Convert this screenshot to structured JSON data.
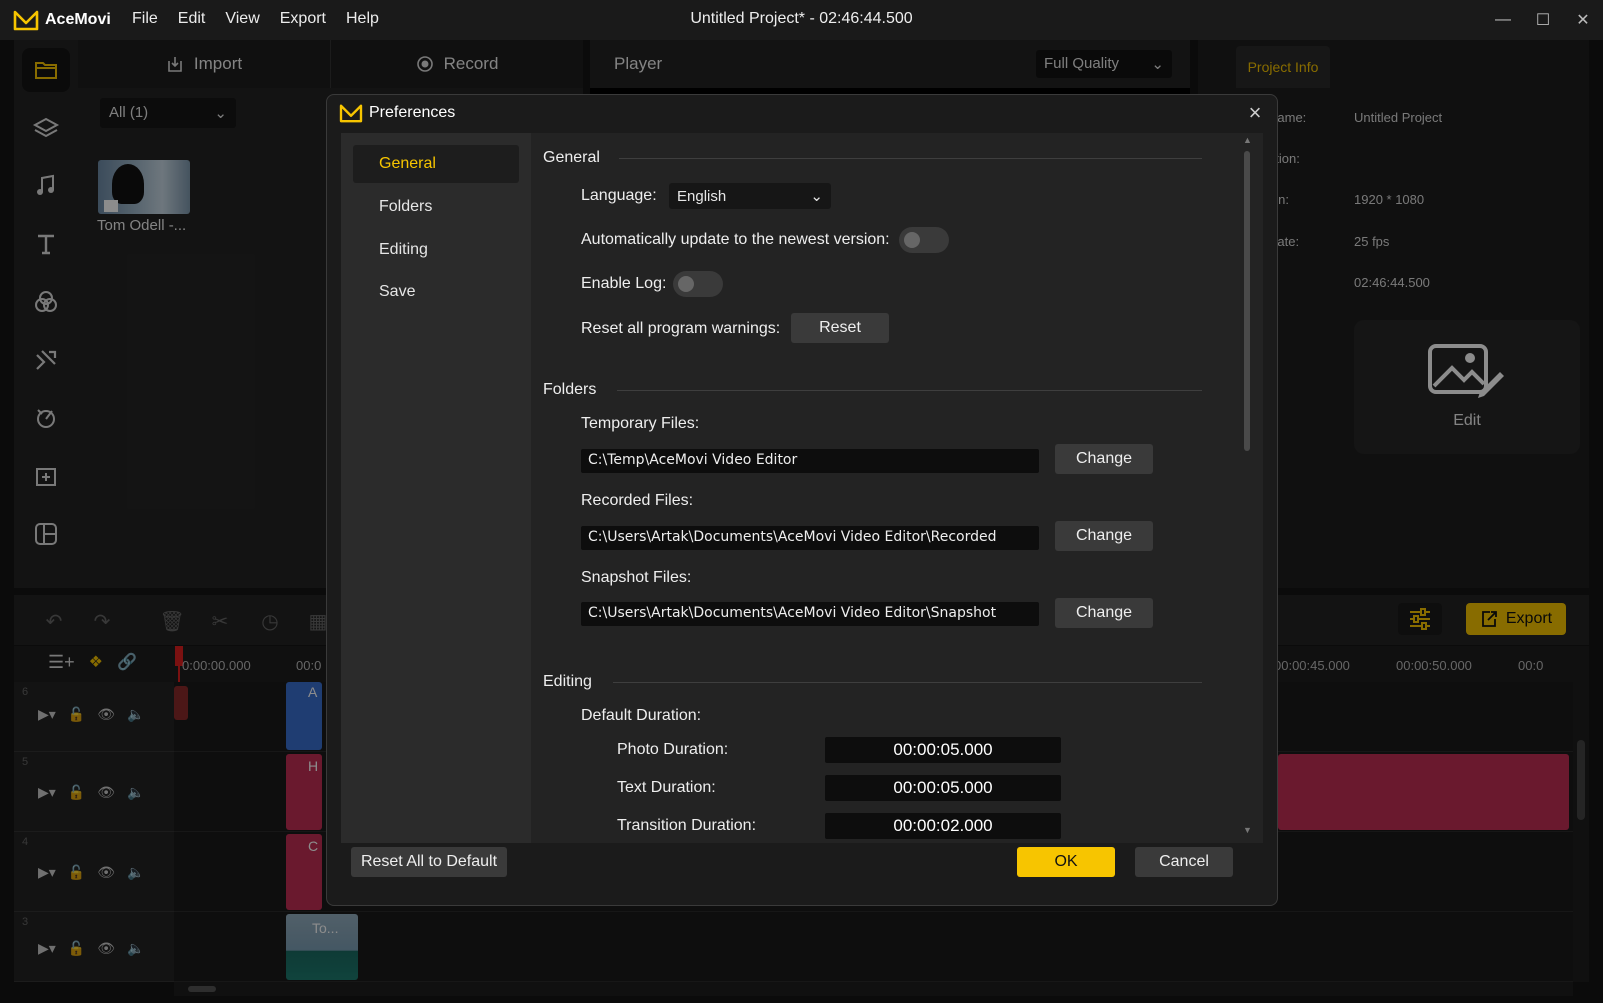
{
  "app": {
    "name": "AceMovi",
    "window_title": "Untitled Project* - 02:46:44.500",
    "menu": [
      "File",
      "Edit",
      "View",
      "Export",
      "Help"
    ]
  },
  "media": {
    "tabs": [
      {
        "label": "Import",
        "icon": "import-icon"
      },
      {
        "label": "Record",
        "icon": "record-icon"
      }
    ],
    "filter": "All (1)",
    "item_label": "Tom Odell -..."
  },
  "player": {
    "title": "Player",
    "quality": "Full Quality"
  },
  "project_info": {
    "tab": "Project Info",
    "rows": [
      {
        "label": "Name:",
        "value": "Untitled Project"
      },
      {
        "label": "ation:",
        "value": ""
      },
      {
        "label": "ion:",
        "value": "1920 * 1080"
      },
      {
        "label": "Rate:",
        "value": "25 fps"
      },
      {
        "label": "n:",
        "value": "02:46:44.500"
      }
    ],
    "edit_label": "Edit"
  },
  "timeline": {
    "export_label": "Export",
    "ruler": [
      "0:00:00.000",
      "00:0",
      "00:00:45.000",
      "00:00:50.000",
      "00:0"
    ],
    "tracks": [
      {
        "num": "6"
      },
      {
        "num": "5"
      },
      {
        "num": "4"
      },
      {
        "num": "3"
      }
    ],
    "clips": {
      "video_label": "To...",
      "label_a": "A",
      "label_h": "H",
      "label_c": "C"
    }
  },
  "preferences": {
    "title": "Preferences",
    "nav": [
      "General",
      "Folders",
      "Editing",
      "Save"
    ],
    "general": {
      "section": "General",
      "language_label": "Language:",
      "language_value": "English",
      "auto_update_label": "Automatically update to the newest version:",
      "auto_update_on": false,
      "enable_log_label": "Enable Log:",
      "enable_log_on": false,
      "reset_warnings_label": "Reset all program warnings:",
      "reset_button": "Reset"
    },
    "folders": {
      "section": "Folders",
      "temp_label": "Temporary Files:",
      "temp_path": "C:\\Temp\\AceMovi Video Editor",
      "recorded_label": "Recorded Files:",
      "recorded_path": "C:\\Users\\Artak\\Documents\\AceMovi Video Editor\\Recorded",
      "snapshot_label": "Snapshot Files:",
      "snapshot_path": "C:\\Users\\Artak\\Documents\\AceMovi Video Editor\\Snapshot",
      "change_button": "Change"
    },
    "editing": {
      "section": "Editing",
      "default_duration_label": "Default Duration:",
      "photo_label": "Photo Duration:",
      "photo_value": "00:00:05.000",
      "text_label": "Text Duration:",
      "text_value": "00:00:05.000",
      "transition_label": "Transition Duration:",
      "transition_value": "00:00:02.000"
    },
    "footer": {
      "reset_all": "Reset All to Default",
      "ok": "OK",
      "cancel": "Cancel"
    }
  },
  "colors": {
    "accent": "#f7c500",
    "clip_pink": "#c22e55",
    "clip_blue": "#3a6fd0"
  }
}
